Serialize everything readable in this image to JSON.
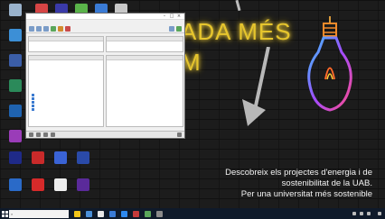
{
  "wallpaper": {
    "neon_line1": "ADA MÉS",
    "neon_line2": "M",
    "promo_line1": "Descobreix els projectes d'energia i de",
    "promo_line2": "sostenibilitat de la UAB.",
    "promo_line3": "Per una universitat més sostenible",
    "neon_color": "#e6c52d"
  },
  "desktop_icons": [
    {
      "name": "desktop-icon-recycle-bin",
      "color": "#9ab3cc"
    },
    {
      "name": "desktop-icon-app-2",
      "color": "#3c8fd6"
    },
    {
      "name": "desktop-icon-app-3",
      "color": "#c43a3a"
    },
    {
      "name": "desktop-icon-app-4",
      "color": "#2b8a5a"
    },
    {
      "name": "desktop-icon-app-5",
      "color": "#3b5ea8"
    },
    {
      "name": "desktop-icon-app-6",
      "color": "#9a3cb8"
    },
    {
      "name": "desktop-icon-app-7",
      "color": "#1f63b0"
    },
    {
      "name": "desktop-icon-app-8",
      "color": "#c92a2a"
    },
    {
      "name": "desktop-icon-app-9",
      "color": "#e8e8e8"
    },
    {
      "name": "desktop-icon-app-10",
      "color": "#5a2a9a"
    }
  ],
  "window": {
    "title": "",
    "menu": [
      "",
      "",
      "",
      "",
      "",
      "",
      ""
    ],
    "left_pane_header": "",
    "right_pane_header": "",
    "rows": [
      "",
      "",
      "",
      "",
      ""
    ]
  },
  "taskbar": {
    "search_placeholder": "",
    "time": "",
    "colors": [
      "#f0c419",
      "#4a90d9",
      "#e8e8e8",
      "#3a7bd5",
      "#2d89ef",
      "#c43a3a",
      "#5aa65a",
      "#8a8a8a"
    ]
  }
}
